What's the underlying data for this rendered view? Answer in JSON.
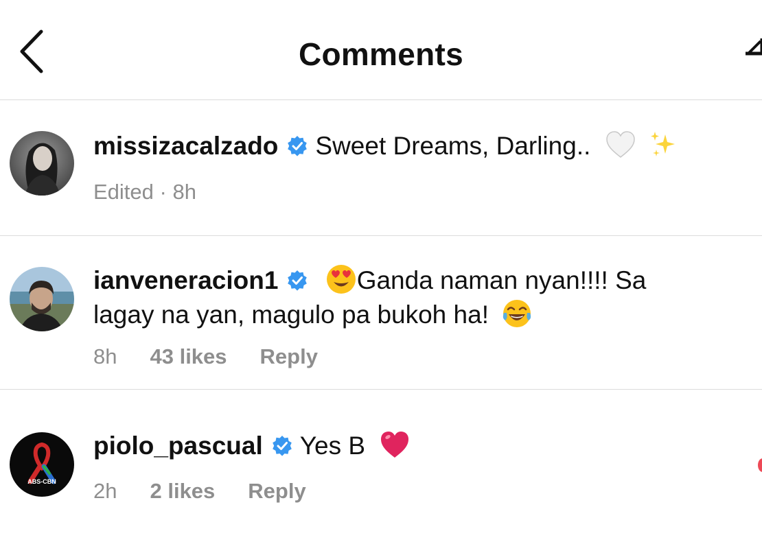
{
  "header": {
    "title": "Comments"
  },
  "comments": [
    {
      "username": "missizacalzado",
      "text": "Sweet Dreams, Darling..",
      "meta": {
        "edited": "Edited",
        "separator": "·",
        "time": "8h"
      }
    },
    {
      "username": "ianveneracion1",
      "text_line1": "Ganda naman nyan!!!! Sa",
      "text_line2": "lagay na yan, magulo pa bukoh ha!",
      "meta": {
        "time": "8h",
        "likes": "43 likes",
        "reply": "Reply"
      }
    },
    {
      "username": "piolo_pascual",
      "text": "Yes B",
      "avatar_text": "ABS-CBN",
      "meta": {
        "time": "2h",
        "likes": "2 likes",
        "reply": "Reply"
      }
    }
  ],
  "colors": {
    "verified": "#3897f0",
    "meta_text": "#8e8e8e",
    "divider": "#dbdbdb",
    "heart_red": "#e0245e"
  },
  "icons": {
    "back": "chevron-left-icon",
    "share": "send-icon",
    "verified": "verified-badge-icon"
  }
}
